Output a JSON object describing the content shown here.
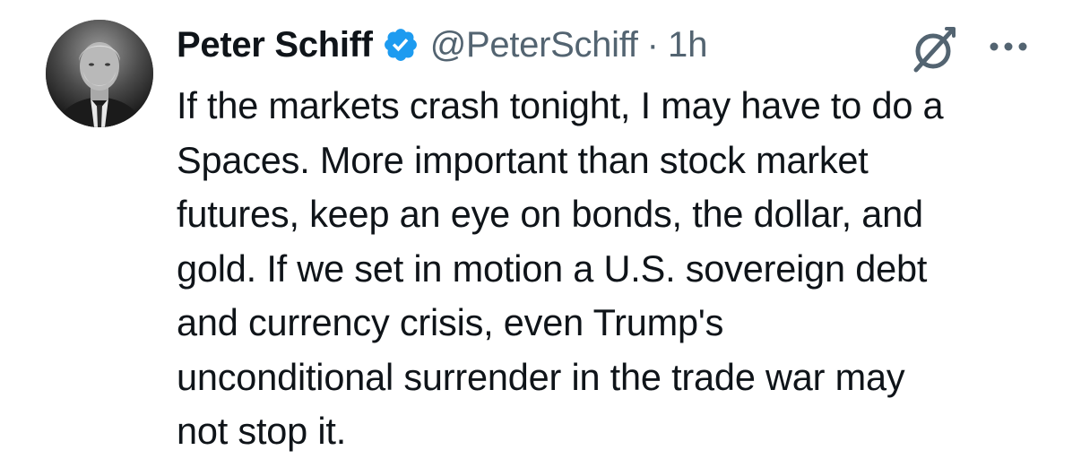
{
  "tweet": {
    "author": {
      "name": "Peter Schiff",
      "handle": "@PeterSchiff",
      "verified": true,
      "avatar_icon": "profile-photo"
    },
    "separator": "·",
    "timestamp": "1h",
    "text_lines": [
      "If the markets crash tonight, I may have to do a",
      "Spaces. More important than stock market",
      "futures, keep an eye on bonds, the dollar, and",
      "gold. If we set in motion a U.S. sovereign debt",
      "and currency crisis, even Trump's",
      "unconditional surrender in the trade war may",
      "not stop it."
    ],
    "actions": {
      "grok_icon": "grok-icon",
      "more_icon": "more-options-icon"
    }
  },
  "colors": {
    "text_primary": "#0f1419",
    "text_secondary": "#536471",
    "verified_blue": "#1d9bf0"
  }
}
